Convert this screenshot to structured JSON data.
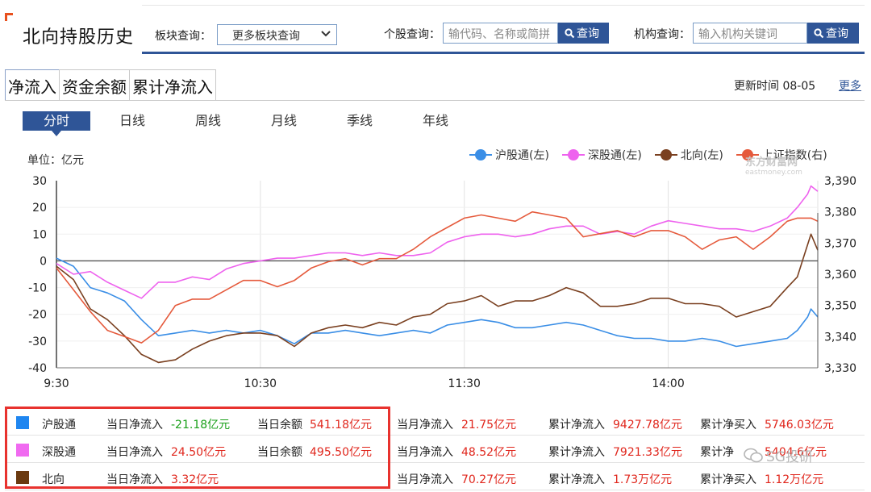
{
  "header": {
    "title": "北向持股历史",
    "sector_label": "板块查询：",
    "sector_selected": "更多板块查询",
    "stock_label": "个股查询：",
    "stock_placeholder": "输代码、名称或简拼",
    "stock_button": "查询",
    "org_label": "机构查询：",
    "org_placeholder": "输入机构关键词",
    "org_button": "查询"
  },
  "tabs": [
    {
      "label": "净流入",
      "active": true
    },
    {
      "label": "资金余额",
      "active": false
    },
    {
      "label": "累计净流入",
      "active": false
    }
  ],
  "update": {
    "label": "更新时间 08-05",
    "more": "更多"
  },
  "periods": [
    {
      "label": "分时",
      "active": true
    },
    {
      "label": "日线",
      "active": false
    },
    {
      "label": "周线",
      "active": false
    },
    {
      "label": "月线",
      "active": false
    },
    {
      "label": "季线",
      "active": false
    },
    {
      "label": "年线",
      "active": false
    }
  ],
  "watermark": {
    "name": "东方财富网",
    "domain": "eastmoney.com"
  },
  "chart_data": {
    "type": "line",
    "unit_label": "单位：亿元",
    "x_ticks": [
      "9:30",
      "10:30",
      "11:30",
      "14:00"
    ],
    "x_tick_index": [
      0,
      60,
      120,
      180
    ],
    "x_count": 225,
    "y_left": {
      "ticks": [
        30,
        20,
        10,
        0,
        -10,
        -20,
        -30,
        -40
      ],
      "range": [
        -40,
        30
      ]
    },
    "y_right": {
      "ticks": [
        "3,390",
        "3,380",
        "3,370",
        "3,360",
        "3,350",
        "3,340",
        "3,330"
      ],
      "range": [
        3330,
        3390
      ]
    },
    "series": [
      {
        "name": "沪股通(左)",
        "color": "#3a8ee6",
        "axis": "left",
        "points": [
          [
            0,
            1
          ],
          [
            5,
            -2
          ],
          [
            10,
            -10
          ],
          [
            15,
            -12
          ],
          [
            20,
            -15
          ],
          [
            25,
            -22
          ],
          [
            30,
            -28
          ],
          [
            35,
            -27
          ],
          [
            40,
            -26
          ],
          [
            45,
            -27
          ],
          [
            50,
            -26
          ],
          [
            55,
            -27
          ],
          [
            60,
            -26
          ],
          [
            65,
            -28
          ],
          [
            70,
            -31
          ],
          [
            75,
            -27
          ],
          [
            80,
            -27
          ],
          [
            85,
            -26
          ],
          [
            90,
            -27
          ],
          [
            95,
            -28
          ],
          [
            100,
            -27
          ],
          [
            105,
            -26
          ],
          [
            110,
            -27
          ],
          [
            115,
            -24
          ],
          [
            120,
            -23
          ],
          [
            125,
            -22
          ],
          [
            130,
            -23
          ],
          [
            135,
            -25
          ],
          [
            140,
            -25
          ],
          [
            145,
            -24
          ],
          [
            150,
            -23
          ],
          [
            155,
            -24
          ],
          [
            160,
            -26
          ],
          [
            165,
            -28
          ],
          [
            170,
            -29
          ],
          [
            175,
            -29
          ],
          [
            180,
            -30
          ],
          [
            185,
            -30
          ],
          [
            190,
            -29
          ],
          [
            195,
            -30
          ],
          [
            200,
            -32
          ],
          [
            205,
            -31
          ],
          [
            210,
            -30
          ],
          [
            215,
            -29
          ],
          [
            218,
            -26
          ],
          [
            221,
            -21
          ],
          [
            222,
            -18
          ],
          [
            224,
            -21
          ]
        ]
      },
      {
        "name": "深股通(左)",
        "color": "#ee62ee",
        "axis": "left",
        "points": [
          [
            0,
            -1
          ],
          [
            5,
            -5
          ],
          [
            10,
            -4
          ],
          [
            15,
            -8
          ],
          [
            20,
            -11
          ],
          [
            25,
            -14
          ],
          [
            30,
            -8
          ],
          [
            35,
            -8
          ],
          [
            40,
            -6
          ],
          [
            45,
            -7
          ],
          [
            50,
            -3
          ],
          [
            55,
            -1
          ],
          [
            60,
            0
          ],
          [
            65,
            1
          ],
          [
            70,
            1
          ],
          [
            75,
            2
          ],
          [
            80,
            3
          ],
          [
            85,
            3
          ],
          [
            90,
            2
          ],
          [
            95,
            3
          ],
          [
            100,
            2
          ],
          [
            105,
            2
          ],
          [
            110,
            3
          ],
          [
            115,
            7
          ],
          [
            120,
            9
          ],
          [
            125,
            10
          ],
          [
            130,
            10
          ],
          [
            135,
            9
          ],
          [
            140,
            10
          ],
          [
            145,
            12
          ],
          [
            150,
            13
          ],
          [
            155,
            13
          ],
          [
            160,
            10
          ],
          [
            165,
            11
          ],
          [
            170,
            10
          ],
          [
            175,
            13
          ],
          [
            180,
            15
          ],
          [
            185,
            14
          ],
          [
            190,
            13
          ],
          [
            195,
            12
          ],
          [
            200,
            12
          ],
          [
            205,
            11
          ],
          [
            210,
            13
          ],
          [
            215,
            16
          ],
          [
            218,
            20
          ],
          [
            221,
            25
          ],
          [
            222,
            28
          ],
          [
            224,
            26
          ]
        ]
      },
      {
        "name": "北向(左)",
        "color": "#7a4020",
        "axis": "left",
        "points": [
          [
            0,
            -2
          ],
          [
            5,
            -7
          ],
          [
            10,
            -18
          ],
          [
            15,
            -22
          ],
          [
            20,
            -28
          ],
          [
            25,
            -35
          ],
          [
            30,
            -38
          ],
          [
            35,
            -37
          ],
          [
            40,
            -33
          ],
          [
            45,
            -30
          ],
          [
            50,
            -28
          ],
          [
            55,
            -27
          ],
          [
            60,
            -27
          ],
          [
            65,
            -28
          ],
          [
            70,
            -32
          ],
          [
            75,
            -27
          ],
          [
            80,
            -25
          ],
          [
            85,
            -24
          ],
          [
            90,
            -25
          ],
          [
            95,
            -23
          ],
          [
            100,
            -24
          ],
          [
            105,
            -21
          ],
          [
            110,
            -20
          ],
          [
            115,
            -16
          ],
          [
            120,
            -15
          ],
          [
            125,
            -13
          ],
          [
            130,
            -17
          ],
          [
            135,
            -15
          ],
          [
            140,
            -15
          ],
          [
            145,
            -13
          ],
          [
            150,
            -10
          ],
          [
            155,
            -12
          ],
          [
            160,
            -17
          ],
          [
            165,
            -17
          ],
          [
            170,
            -16
          ],
          [
            175,
            -14
          ],
          [
            180,
            -14
          ],
          [
            185,
            -16
          ],
          [
            190,
            -16
          ],
          [
            195,
            -17
          ],
          [
            200,
            -21
          ],
          [
            205,
            -19
          ],
          [
            210,
            -17
          ],
          [
            215,
            -10
          ],
          [
            218,
            -6
          ],
          [
            220,
            2
          ],
          [
            222,
            10
          ],
          [
            224,
            4
          ]
        ]
      },
      {
        "name": "上证指数(右)",
        "color": "#e55a3c",
        "axis": "right",
        "points": [
          [
            0,
            3362
          ],
          [
            5,
            3355
          ],
          [
            10,
            3348
          ],
          [
            15,
            3342
          ],
          [
            20,
            3340
          ],
          [
            25,
            3338
          ],
          [
            30,
            3342
          ],
          [
            35,
            3350
          ],
          [
            40,
            3352
          ],
          [
            45,
            3352
          ],
          [
            50,
            3355
          ],
          [
            55,
            3358
          ],
          [
            60,
            3358
          ],
          [
            65,
            3356
          ],
          [
            70,
            3358
          ],
          [
            75,
            3362
          ],
          [
            80,
            3364
          ],
          [
            85,
            3365
          ],
          [
            90,
            3363
          ],
          [
            95,
            3365
          ],
          [
            100,
            3365
          ],
          [
            105,
            3368
          ],
          [
            110,
            3372
          ],
          [
            115,
            3375
          ],
          [
            120,
            3378
          ],
          [
            125,
            3379
          ],
          [
            130,
            3378
          ],
          [
            135,
            3377
          ],
          [
            140,
            3380
          ],
          [
            145,
            3379
          ],
          [
            150,
            3378
          ],
          [
            155,
            3372
          ],
          [
            160,
            3373
          ],
          [
            165,
            3374
          ],
          [
            170,
            3372
          ],
          [
            175,
            3374
          ],
          [
            180,
            3374
          ],
          [
            185,
            3372
          ],
          [
            190,
            3368
          ],
          [
            195,
            3371
          ],
          [
            200,
            3372
          ],
          [
            205,
            3368
          ],
          [
            210,
            3372
          ],
          [
            215,
            3377
          ],
          [
            218,
            3378
          ],
          [
            222,
            3378
          ],
          [
            224,
            3377
          ]
        ]
      }
    ]
  },
  "bottom": {
    "rows": [
      {
        "name": "沪股通",
        "color": "#1f86f0",
        "day_flow_label": "当日净流入",
        "day_flow_value": "-21.18亿元",
        "day_flow_sign": "neg",
        "balance_label": "当日余额",
        "balance_value": "541.18亿元",
        "month_label": "当月净流入",
        "month_value": "21.75亿元",
        "cum_flow_label": "累计净流入",
        "cum_flow_value": "9427.78亿元",
        "cum_buy_label": "累计净买入",
        "cum_buy_value": "5746.03亿元"
      },
      {
        "name": "深股通",
        "color": "#f06af0",
        "day_flow_label": "当日净流入",
        "day_flow_value": "24.50亿元",
        "day_flow_sign": "pos",
        "balance_label": "当日余额",
        "balance_value": "495.50亿元",
        "month_label": "当月净流入",
        "month_value": "48.52亿元",
        "cum_flow_label": "累计净流入",
        "cum_flow_value": "7921.33亿元",
        "cum_buy_label": "累计净",
        "cum_buy_value": "5404.6亿元"
      },
      {
        "name": "北向",
        "color": "#6b3a10",
        "day_flow_label": "当日净流入",
        "day_flow_value": "3.32亿元",
        "day_flow_sign": "pos",
        "balance_label": "",
        "balance_value": "",
        "month_label": "当月净流入",
        "month_value": "70.27亿元",
        "cum_flow_label": "累计净流入",
        "cum_flow_value": "1.73万亿元",
        "cum_buy_label": "累计净买入",
        "cum_buy_value": "1.12万亿元"
      }
    ]
  },
  "overlay": {
    "wechat_text": "SG投研"
  }
}
